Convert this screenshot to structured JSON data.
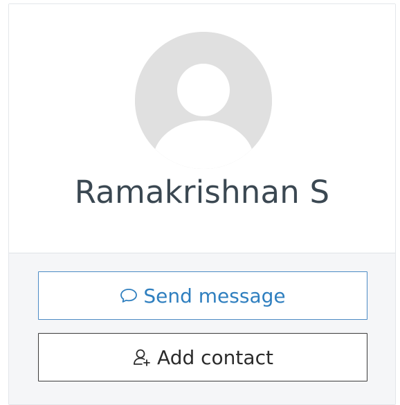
{
  "profile": {
    "name": "Ramakrishnan S",
    "avatar_icon": "default-user-avatar"
  },
  "actions": {
    "send_message_label": "Send message",
    "send_message_icon": "speech-bubble-icon",
    "add_contact_label": "Add contact",
    "add_contact_icon": "user-plus-icon"
  },
  "colors": {
    "name_text": "#3b4852",
    "primary_outline": "#2f7fbf",
    "secondary_outline": "#2b2b2b",
    "avatar_bg": "#e0e0e0",
    "footer_bg": "#f5f6f8"
  }
}
